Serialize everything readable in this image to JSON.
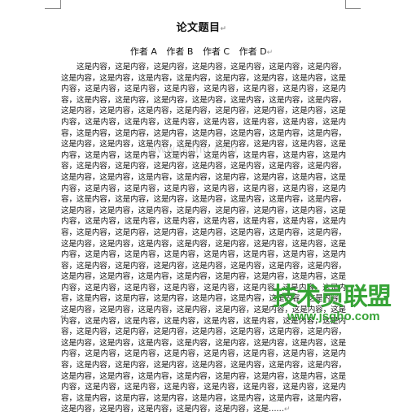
{
  "document": {
    "title": "论文题目",
    "title_mark": "↵",
    "authors": [
      "作者 A",
      "作者 B",
      "作者 C",
      "作者 D"
    ],
    "author_mark": "↵",
    "body_text": "这是内容，这是内容，这是内容，这是内容，这是内容，这是内容，这是内容，这是内容，这是内容，这是内容，这是内容，这是内容，这是内容，这是内容，这是内容，这是内容，这是内容，这是内容，这是内容，这是内容，这是内容，这是内容，这是内容，这是内容，这是内容，这是内容，这是内容，这是内容，这是内容，这是内容，这是内容，这是内容，这是内容，这是内容，这是内容，这是内容，这是内容，这是内容，这是内容，这是内容，这是内容，这是内容，这是内容，这是内容，这是内容，这是内容，这是内容，这是内容，这是内容，这是内容，这是内容，这是内容，这是内容，这是内容，这是内容，这是内容，这是内容，这是内容，这是内容，这是内容，这是内容，这是内容，这是内容，这是内容，这是内容，这是内容，这是内容，这是内容，这是内容，这是内容，这是内容，这是内容，这是内容，这是内容，这是内容，这是内容，这是内容，这是内容，这是内容，这是内容，这是内容，这是内容，这是内容，这是内容，这是内容，这是内容，这是内容，这是内容，这是内容，这是内容，这是内容，这是内容，这是内容，这是内容，这是内容，这是内容，这是内容，这是内容，这是内容，这是内容，这是内容，这是内容，这是内容，这是内容，这是内容，这是内容，这是内容，这是内容，这是内容，这是内容，这是内容，这是内容，这是内容，这是内容，这是内容，这是内容，这是内容，这是内容，这是内容，这是内容，这是内容，这是内容，这是内容，这是内容，这是内容，这是内容，这是内容，这是内容，这是内容，这是内容，这是内容，这是内容，这是内容，这是内容，这是内容，这是内容，这是内容，这是内容，这是内容，这是内容，这是内容，这是内容，这是内容，这是内容，这是内容，这是内容，这是内容，这是内容，这是内容，这是内容，这是内容，这是内容，这是内容，这是内容，这是内容，这是内容，这是内容，这是内容，这是内容，这是内容，这是内容，这是内容，这是内容，这是内容，这是内容，这是内容，这是内容，这是内容，这是内容，这是内容，这是内容，这是内容，这是内容，这是内容，这是内容，这是内容，这是内容，这是内容，这是内容，这是内容，这是内容，这是内容，这是内容，这是内容，这是内容，这是内容，这是内容，这是内容，这是内容，这是内容，这是内容，这是内容，这是内容，这是内容，这是内容，这是内容，这是内容，这是内容，这是内容，这是内容，这是内容，这是内容，这是内容，这是内容，这是内容，这是内容，这是内容，这是内容，这是内容，这是内容，这是内容，这是内容，这是内容，这是内容，这是内容，这是内容，这是内容，这是内容，这是内容，这是内容，这是内容，这是内容，这是内容，这是内容，这是内容，这是内容，这是内容，这是内容，这是内容，这是内容，这是内容，这是内容，这是……",
    "body_end_mark": "↵",
    "trailing_mark": "↵"
  },
  "watermark": {
    "url_text": "www.jsgho.com"
  },
  "logo": {
    "main_text": "技术员联盟",
    "url_text": "www.jsgho.com",
    "color": "#37a437"
  }
}
